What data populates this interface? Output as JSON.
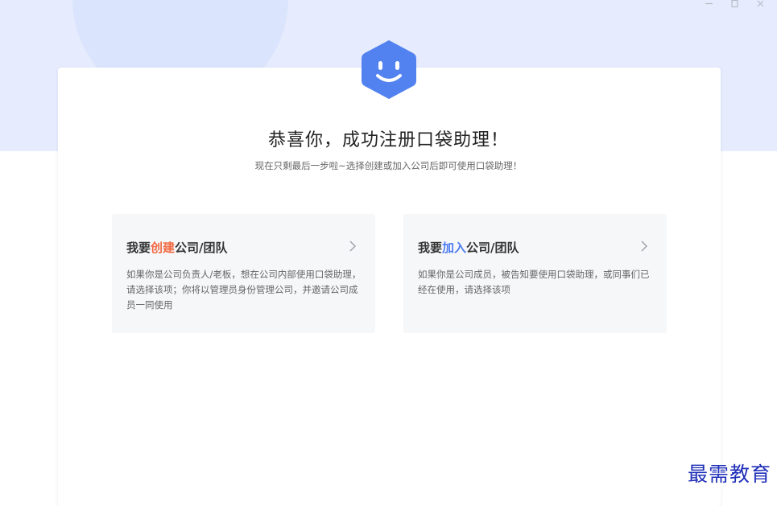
{
  "window": {
    "controls": [
      "minimize-icon",
      "maximize-icon",
      "close-icon"
    ]
  },
  "logo": {
    "icon": "smiley-hexagon-icon",
    "color": "#5281f0"
  },
  "main": {
    "title": "恭喜你，成功注册口袋助理！",
    "subtitle": "现在只剩最后一步啦~选择创建或加入公司后即可使用口袋助理！"
  },
  "options": {
    "create": {
      "prefix": "我要",
      "highlight": "创建",
      "suffix": "公司/团队",
      "description": "如果你是公司负责人/老板，想在公司内部使用口袋助理，请选择该项；你将以管理员身份管理公司，并邀请公司成员一同使用",
      "highlight_color": "#f26a43",
      "icon": "chevron-right-icon"
    },
    "join": {
      "prefix": "我要",
      "highlight": "加入",
      "suffix": "公司/团队",
      "description": "如果你是公司成员，被告知要使用口袋助理，或同事们已经在使用，请选择该项",
      "highlight_color": "#4f7cf0",
      "icon": "chevron-right-icon"
    }
  },
  "watermark": {
    "text": "最需教育"
  },
  "colors": {
    "background_band": "#e6ecfd",
    "accent": "#5281f0"
  }
}
